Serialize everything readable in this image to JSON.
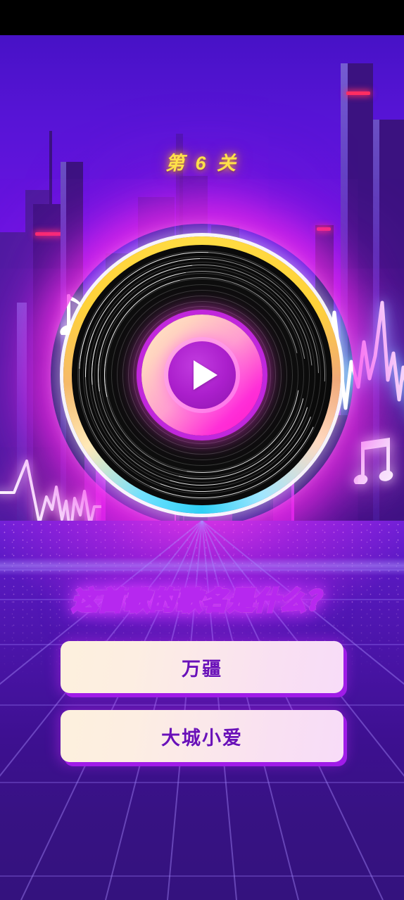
{
  "app": {
    "kind": "music-guess-game",
    "statusbar_color": "#000000"
  },
  "header": {
    "level_label": "第 6 关",
    "level_number": 6,
    "level_text_color": "#ffe14a"
  },
  "player": {
    "play_icon": "play-triangle-icon",
    "record_rim_top_color": "#ffd23a",
    "record_rim_bottom_color": "#2fd0f5",
    "label_gradient_from": "#ffe7c9",
    "label_gradient_to": "#ff17c8",
    "play_button_color": "#ab1fcc"
  },
  "question": {
    "text": "这首歌的歌名是什么？",
    "gradient_from": "#cdf3dd",
    "gradient_to": "#fff0a8",
    "outline_color": "#b628ef"
  },
  "answers": {
    "options": [
      {
        "label": "万疆"
      },
      {
        "label": "大城小爱"
      }
    ],
    "text_color": "#6a11b8",
    "shadow_color": "#a01ce8"
  },
  "decor": {
    "note_single": "music-note-icon",
    "note_double": "double-music-note-icon",
    "waveform_left": "waveform-left",
    "waveform_right": "waveform-right",
    "skyline": "city-skyline",
    "floor": "perspective-grid-floor",
    "sky_color_top": "#4712c6",
    "sky_color_bottom": "#b020d8",
    "floor_color": "#34127e"
  }
}
